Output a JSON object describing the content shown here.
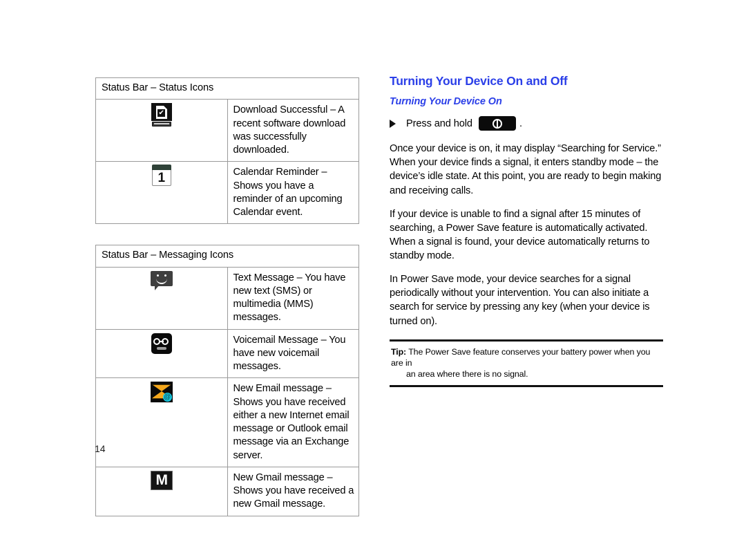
{
  "page": {
    "number": "14",
    "accent_blue": "#2B3FE8"
  },
  "left_column": {
    "tables": [
      {
        "title": "Status Bar – Status Icons",
        "rows": [
          {
            "icon": "download-successful-icon",
            "icon_glyph": "✔",
            "description": "Download Successful – A recent software download was successfully downloaded."
          },
          {
            "icon": "calendar-reminder-icon",
            "icon_glyph": "1",
            "description": "Calendar Reminder – Shows you have a reminder of an upcoming Calendar event."
          }
        ]
      },
      {
        "title": "Status Bar – Messaging Icons",
        "rows": [
          {
            "icon": "text-message-icon",
            "icon_glyph": "",
            "description": "Text Message – You have new text (SMS) or multimedia (MMS) messages."
          },
          {
            "icon": "voicemail-message-icon",
            "icon_glyph": "",
            "description": "Voicemail Message – You have new voicemail messages."
          },
          {
            "icon": "new-email-message-icon",
            "icon_glyph": "@",
            "description": "New Email message – Shows you have received either a new Internet email message or Outlook email message via an Exchange server."
          },
          {
            "icon": "new-gmail-message-icon",
            "icon_glyph": "M",
            "description": "New Gmail message – Shows you have received a new Gmail message."
          }
        ]
      }
    ]
  },
  "right_column": {
    "heading": "Turning Your Device On and Off",
    "subheading": "Turning Your Device On",
    "bullet": {
      "text": "Press and hold",
      "key_icon": "power-key-icon",
      "trailing": "."
    },
    "paragraphs": [
      "Once your device is on, it may display “Searching for Service.” When your device finds a signal, it enters standby mode – the device’s idle state. At this point, you are ready to begin making and receiving calls.",
      "If your device is unable to find a signal after 15 minutes of searching, a Power Save feature is automatically activated. When a signal is found, your device automatically returns to standby mode.",
      "In Power Save mode, your device searches for a signal periodically without your intervention. You can also initiate a search for service by pressing any key (when your device is turned on)."
    ],
    "tip": {
      "label": "Tip:",
      "line1": "The Power Save feature conserves your battery power when you are in",
      "line2": "an area where there is no signal."
    }
  }
}
